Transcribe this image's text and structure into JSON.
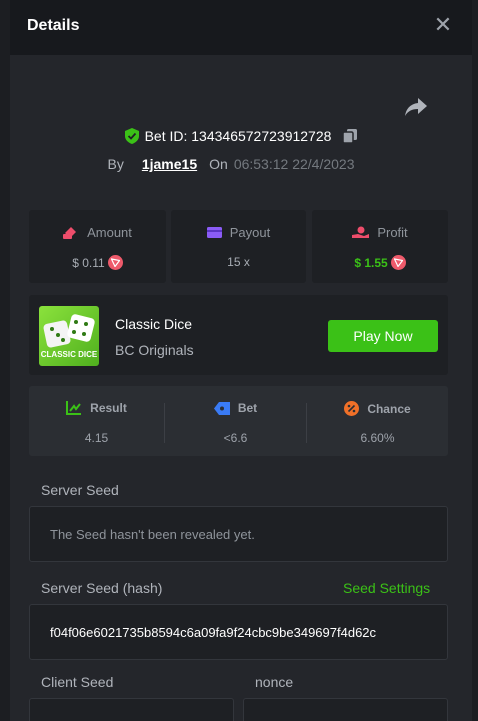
{
  "header": {
    "title": "Details"
  },
  "bet": {
    "id_label": "Bet ID: 134346572723912728",
    "by_label": "By",
    "user": "1jame15",
    "on_label": "On",
    "datetime": "06:53:12 22/4/2023"
  },
  "stats": {
    "amount": {
      "label": "Amount",
      "value": "$ 0.11"
    },
    "payout": {
      "label": "Payout",
      "value": "15 x"
    },
    "profit": {
      "label": "Profit",
      "value": "$ 1.55"
    }
  },
  "game": {
    "thumb_text": "CLASSIC DICE",
    "name": "Classic Dice",
    "provider": "BC Originals",
    "play_label": "Play Now"
  },
  "results": {
    "result": {
      "label": "Result",
      "value": "4.15"
    },
    "bet": {
      "label": "Bet",
      "value": "<6.6"
    },
    "chance": {
      "label": "Chance",
      "value": "6.60%"
    }
  },
  "server_seed": {
    "label": "Server Seed",
    "value": "The Seed hasn't been revealed yet."
  },
  "server_seed_hash": {
    "label": "Server Seed (hash)",
    "settings_label": "Seed Settings",
    "value": "f04f06e6021735b8594c6a09fa9f24cbc9be349697f4d62c"
  },
  "client_seed": {
    "label": "Client Seed"
  },
  "nonce": {
    "label": "nonce"
  },
  "colors": {
    "accent_green": "#3bc117",
    "modal_bg": "#24262b",
    "header_bg": "#17191d",
    "card_bg": "#1e2024"
  },
  "icons": {
    "close": "close-icon",
    "share": "share-icon",
    "shield": "shield-check-icon",
    "copy": "copy-icon",
    "amount": "amount-icon",
    "payout": "wallet-icon",
    "profit": "profit-hand-icon",
    "trx": "trx-coin-icon",
    "result": "result-chart-icon",
    "bet": "bet-tag-icon",
    "chance": "percent-icon"
  }
}
